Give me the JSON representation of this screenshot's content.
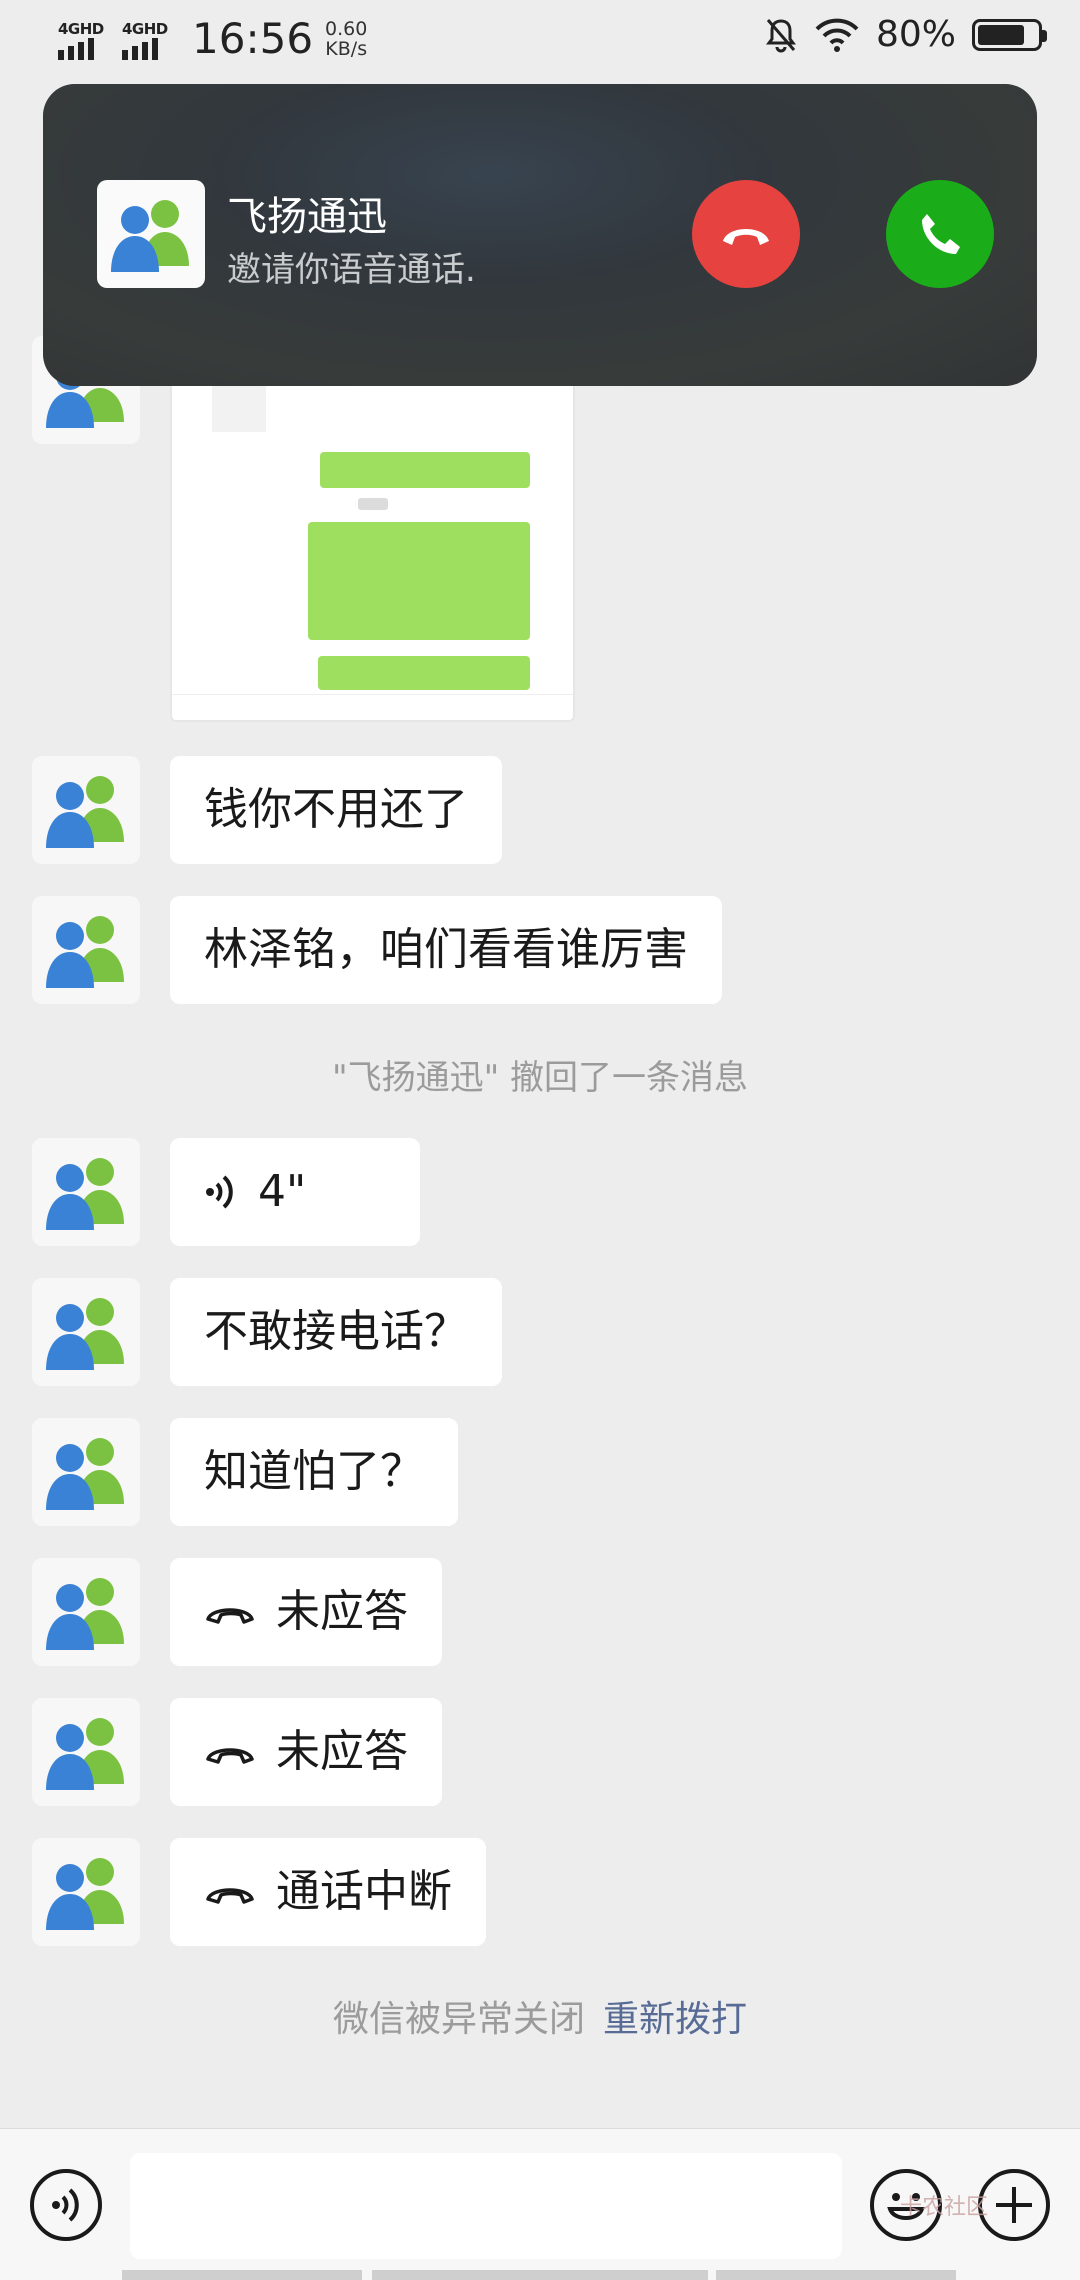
{
  "status_bar": {
    "net1": "4GHD",
    "net2": "4GHD",
    "time": "16:56",
    "speed_value": "0.60",
    "speed_unit": "KB/s",
    "battery_pct": "80%",
    "battery_level": 0.8
  },
  "incoming_call": {
    "caller": "飞扬通迅",
    "subtitle": "邀请你语音通话.",
    "decline_color": "#e64340",
    "accept_color": "#1aad19"
  },
  "messages": [
    {
      "type": "image",
      "sender": "飞扬通迅"
    },
    {
      "type": "text",
      "text": "钱你不用还了"
    },
    {
      "type": "text",
      "text": "林泽铭，咱们看看谁厉害"
    },
    {
      "type": "system",
      "text": "\"飞扬通迅\" 撤回了一条消息"
    },
    {
      "type": "voice",
      "text": "4\""
    },
    {
      "type": "text",
      "text": "不敢接电话？"
    },
    {
      "type": "text",
      "text": "知道怕了？"
    },
    {
      "type": "call",
      "text": "未应答",
      "icon": "hangup-icon"
    },
    {
      "type": "call",
      "text": "未应答",
      "icon": "hangup-icon"
    },
    {
      "type": "call",
      "text": "通话中断",
      "icon": "hangup-icon"
    }
  ],
  "footer_notice": {
    "text": "微信被异常关闭",
    "link": "重新拨打"
  },
  "input_bar": {
    "placeholder": "",
    "voice_icon": "voice-icon",
    "emoji_icon": "emoji-icon",
    "plus_icon": "plus-icon"
  },
  "watermark": "卡农社区"
}
